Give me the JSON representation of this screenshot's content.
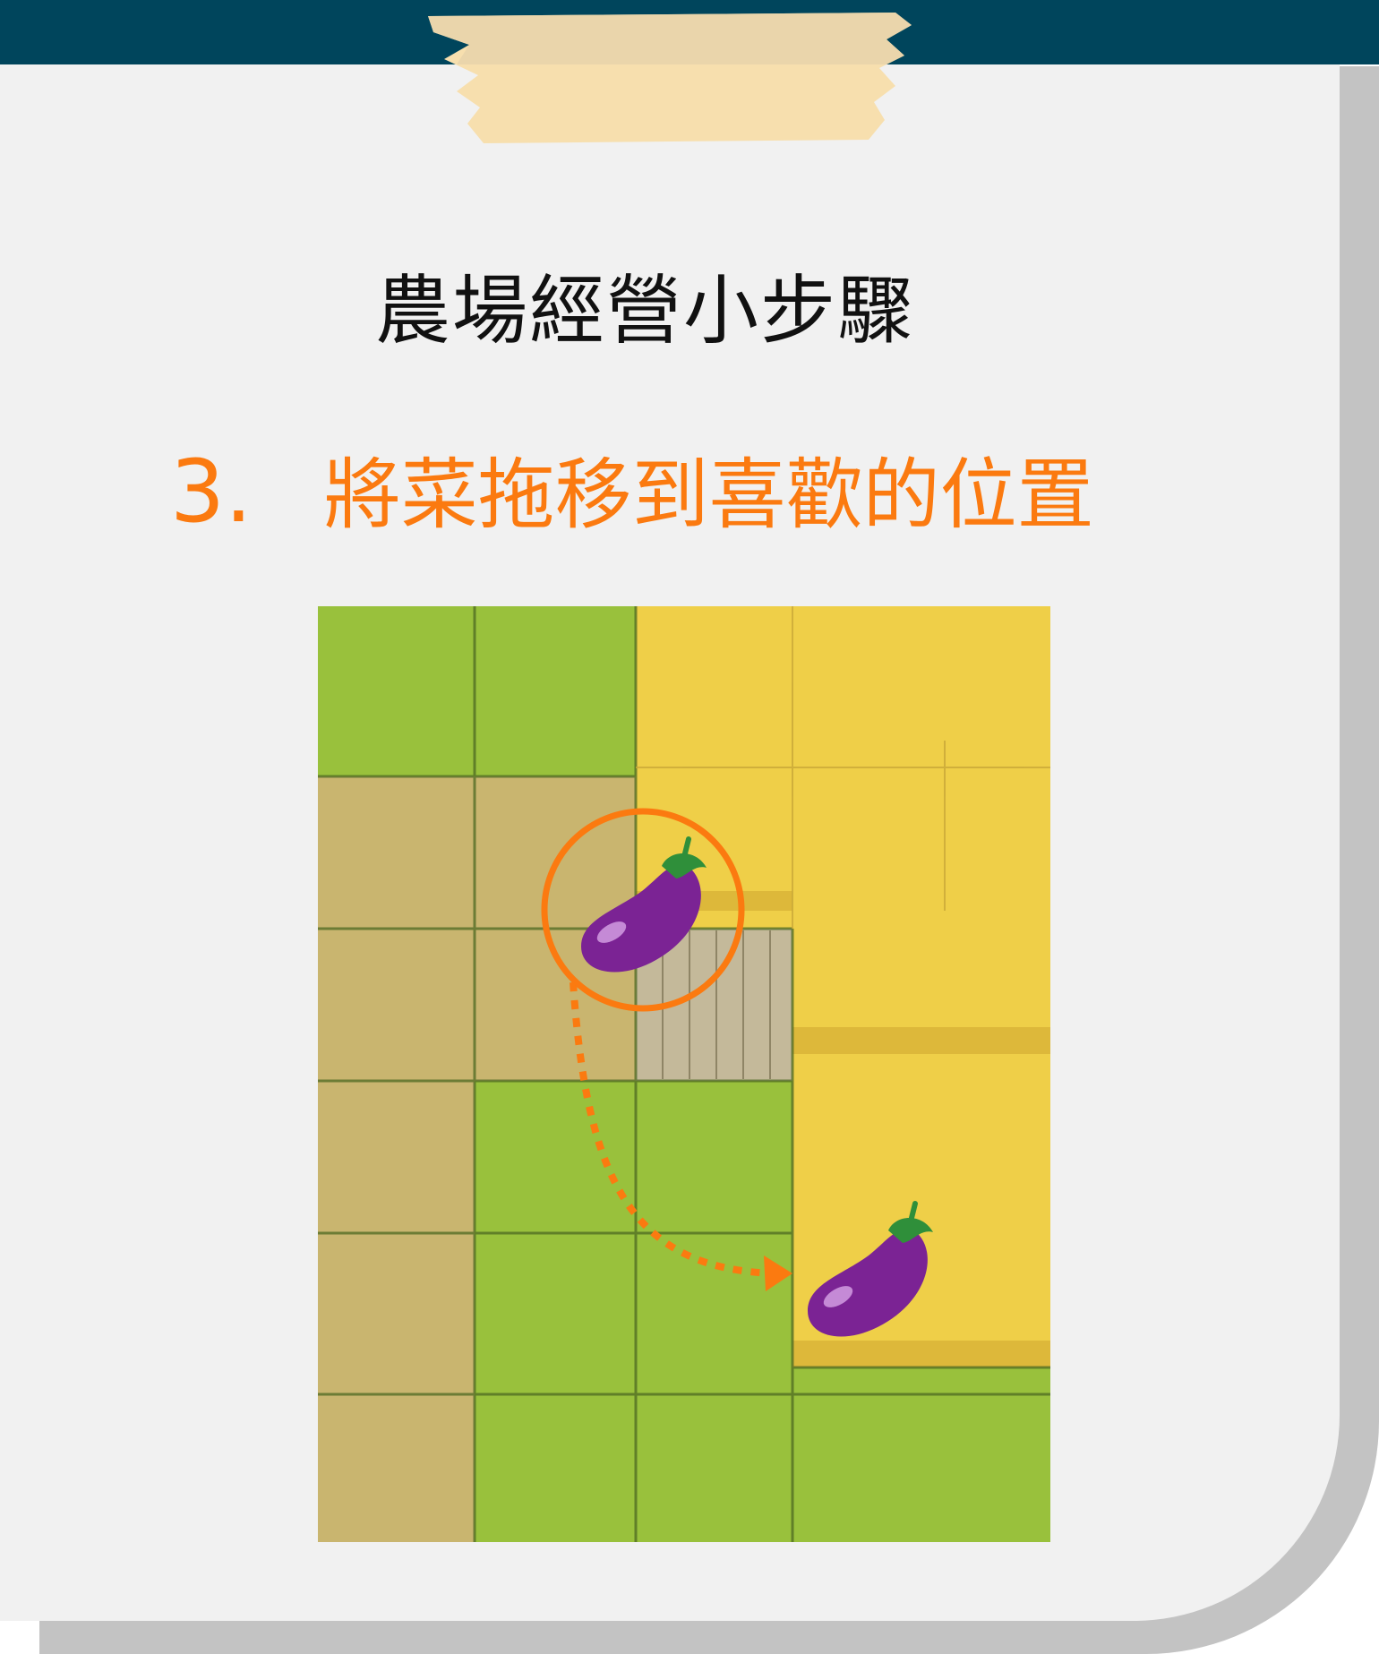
{
  "heading": "農場經營小步驟",
  "step": {
    "number": "3.",
    "text": "將菜拖移到喜歡的位置"
  },
  "illustration": {
    "icons": [
      "eggplant-icon",
      "eggplant-icon",
      "drag-arrow-icon"
    ],
    "colors": {
      "grass": "#99c13c",
      "soil": "#c9b56f",
      "field": "#efcf48",
      "accent": "#fb7a10",
      "eggplant": "#7b2394"
    }
  },
  "colors": {
    "top_bar": "#00455c",
    "tape": "#f7dfae",
    "card": "#f1f1f1",
    "shadow": "#c3c3c3",
    "heading": "#111111",
    "accent": "#fb7a10"
  }
}
